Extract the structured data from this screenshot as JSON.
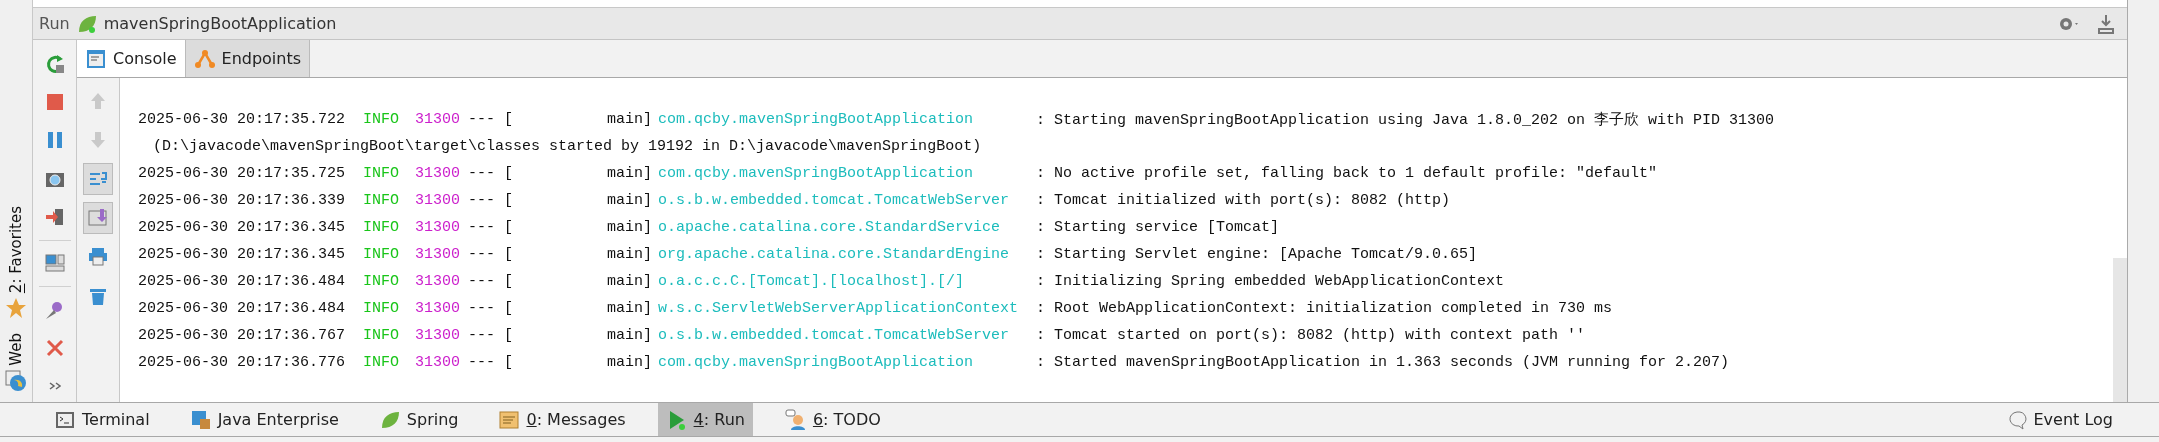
{
  "side_stripe": [
    {
      "kind": "favorites",
      "key": "2",
      "label": ": Favorites"
    },
    {
      "kind": "web",
      "label": "Web"
    }
  ],
  "header": {
    "label": "Run",
    "config": "mavenSpringBootApplication"
  },
  "run_tools": [
    {
      "kind": "rerun"
    },
    {
      "kind": "stop"
    },
    {
      "kind": "pause"
    },
    {
      "kind": "camera"
    },
    {
      "kind": "exit"
    },
    {
      "kind": "layout"
    },
    {
      "kind": "pin"
    },
    {
      "kind": "close"
    },
    {
      "kind": "more"
    }
  ],
  "tabs": [
    {
      "label": "Console",
      "kind": "console",
      "selected": true
    },
    {
      "label": "Endpoints",
      "kind": "endpoints",
      "selected": false
    }
  ],
  "console_tools": [
    {
      "kind": "up",
      "on": false,
      "disabled": true
    },
    {
      "kind": "down",
      "on": false,
      "disabled": true
    },
    {
      "kind": "wrap",
      "on": true,
      "disabled": false
    },
    {
      "kind": "scroll",
      "on": true,
      "disabled": false
    },
    {
      "kind": "print",
      "on": false,
      "disabled": false
    },
    {
      "kind": "trash",
      "on": false,
      "disabled": false
    }
  ],
  "log": [
    {
      "kind": "entry",
      "time": "2025-06-30 20:17:35.722",
      "level": "INFO",
      "pid": "31300",
      "sep": "--- [",
      "thread": "main]",
      "logger": "com.qcby.mavenSpringBootApplication",
      "message": ": Starting mavenSpringBootApplication using Java 1.8.0_202 on 李子欣 with PID 31300"
    },
    {
      "kind": "continuation",
      "text": "(D:\\javacode\\mavenSpringBoot\\target\\classes started by 19192 in D:\\javacode\\mavenSpringBoot)"
    },
    {
      "kind": "entry",
      "time": "2025-06-30 20:17:35.725",
      "level": "INFO",
      "pid": "31300",
      "sep": "--- [",
      "thread": "main]",
      "logger": "com.qcby.mavenSpringBootApplication",
      "message": ": No active profile set, falling back to 1 default profile: \"default\""
    },
    {
      "kind": "entry",
      "time": "2025-06-30 20:17:36.339",
      "level": "INFO",
      "pid": "31300",
      "sep": "--- [",
      "thread": "main]",
      "logger": "o.s.b.w.embedded.tomcat.TomcatWebServer",
      "message": ": Tomcat initialized with port(s): 8082 (http)"
    },
    {
      "kind": "entry",
      "time": "2025-06-30 20:17:36.345",
      "level": "INFO",
      "pid": "31300",
      "sep": "--- [",
      "thread": "main]",
      "logger": "o.apache.catalina.core.StandardService",
      "message": ": Starting service [Tomcat]"
    },
    {
      "kind": "entry",
      "time": "2025-06-30 20:17:36.345",
      "level": "INFO",
      "pid": "31300",
      "sep": "--- [",
      "thread": "main]",
      "logger": "org.apache.catalina.core.StandardEngine",
      "message": ": Starting Servlet engine: [Apache Tomcat/9.0.65]"
    },
    {
      "kind": "entry",
      "time": "2025-06-30 20:17:36.484",
      "level": "INFO",
      "pid": "31300",
      "sep": "--- [",
      "thread": "main]",
      "logger": "o.a.c.c.C.[Tomcat].[localhost].[/]",
      "message": ": Initializing Spring embedded WebApplicationContext"
    },
    {
      "kind": "entry",
      "time": "2025-06-30 20:17:36.484",
      "level": "INFO",
      "pid": "31300",
      "sep": "--- [",
      "thread": "main]",
      "logger": "w.s.c.ServletWebServerApplicationContext",
      "message": ": Root WebApplicationContext: initialization completed in 730 ms"
    },
    {
      "kind": "entry",
      "time": "2025-06-30 20:17:36.767",
      "level": "INFO",
      "pid": "31300",
      "sep": "--- [",
      "thread": "main]",
      "logger": "o.s.b.w.embedded.tomcat.TomcatWebServer",
      "message": ": Tomcat started on port(s): 8082 (http) with context path ''"
    },
    {
      "kind": "entry",
      "time": "2025-06-30 20:17:36.776",
      "level": "INFO",
      "pid": "31300",
      "sep": "--- [",
      "thread": "main]",
      "logger": "com.qcby.mavenSpringBootApplication",
      "message": ": Started mavenSpringBootApplication in 1.363 seconds (JVM running for 2.207)"
    }
  ],
  "bottom_tabs": [
    {
      "kind": "terminal",
      "label": "Terminal",
      "selected": false
    },
    {
      "kind": "enterprise",
      "label": "Java Enterprise",
      "selected": false
    },
    {
      "kind": "spring",
      "label": "Spring",
      "selected": false
    },
    {
      "kind": "messages",
      "key": "0",
      "label": ": Messages",
      "selected": false
    },
    {
      "kind": "run",
      "key": "4",
      "label": ": Run",
      "selected": true
    },
    {
      "kind": "todo",
      "key": "6",
      "label": ": TODO",
      "selected": false
    }
  ],
  "event_log": "Event Log"
}
